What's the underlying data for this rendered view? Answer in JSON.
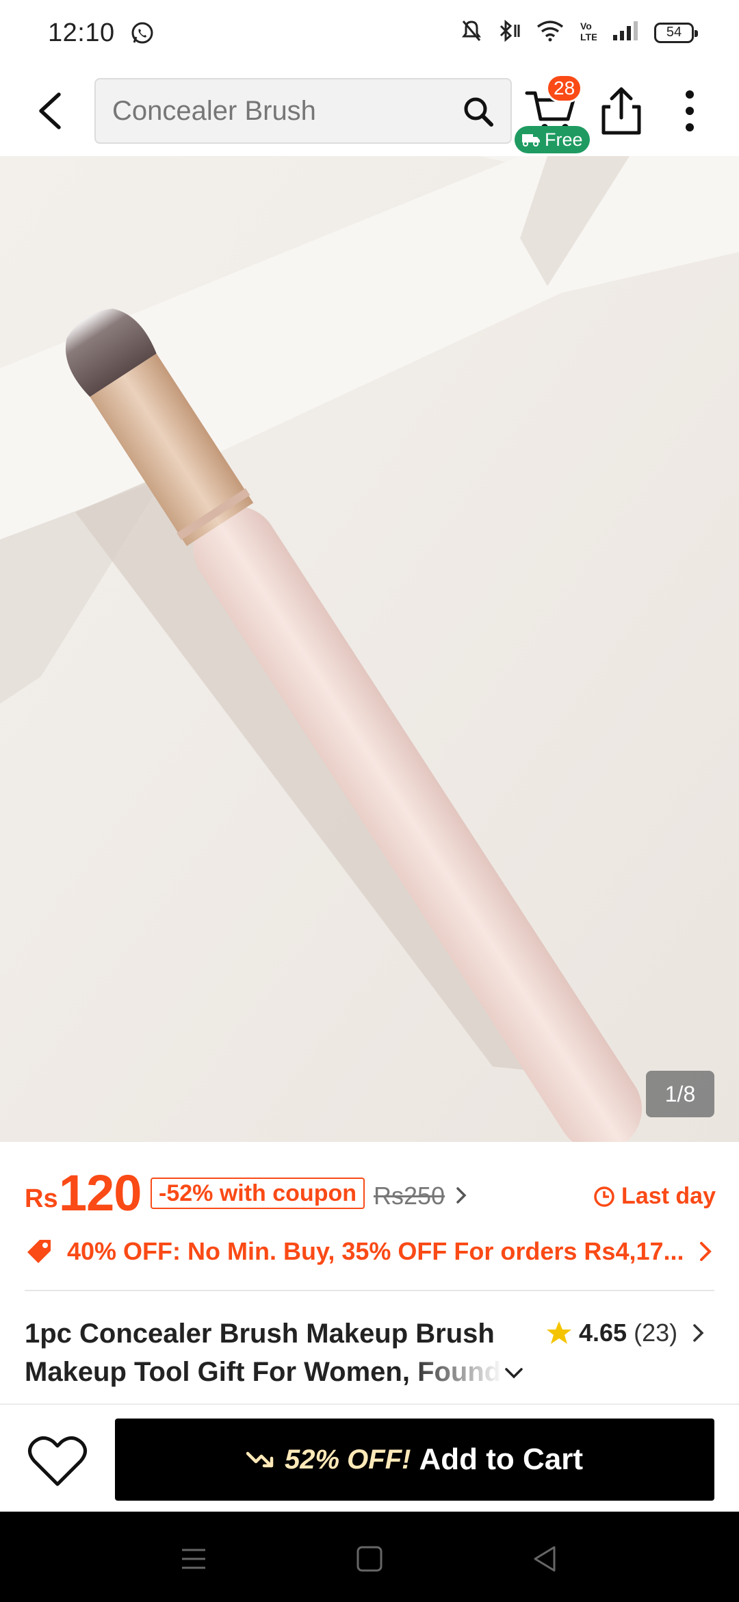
{
  "status_bar": {
    "time": "12:10",
    "battery": "54",
    "icons": [
      "whatsapp-icon",
      "mute-icon",
      "bluetooth-icon",
      "wifi-icon",
      "volte-icon",
      "signal-icon",
      "battery-icon"
    ]
  },
  "header": {
    "search": {
      "value": "Concealer Brush"
    },
    "cart_count": "28",
    "free_badge": "Free",
    "icons": [
      "back-arrow-icon",
      "search-icon",
      "cart-icon",
      "truck-icon",
      "share-icon",
      "more-vertical-icon"
    ]
  },
  "gallery": {
    "counter": "1/8",
    "image_description": "concealer brush product photo"
  },
  "price": {
    "currency": "Rs",
    "amount": "120",
    "coupon": "-52% with coupon",
    "original": "Rs250",
    "last_day": "Last day"
  },
  "promo": {
    "text": "40% OFF: No Min. Buy,  35% OFF For orders Rs4,17..."
  },
  "product": {
    "title_line1": "1pc Concealer Brush Makeup Brush",
    "title_line2": "Makeup Tool Gift For Women, Found",
    "rating": "4.65",
    "reviews": "(23)"
  },
  "bottom_bar": {
    "discount": "52% OFF!",
    "add_to_cart": "Add to Cart"
  },
  "colors": {
    "accent": "#fa4a16",
    "free_green": "#1f9b62",
    "star": "#f5c400",
    "cart_button": "#000000"
  }
}
